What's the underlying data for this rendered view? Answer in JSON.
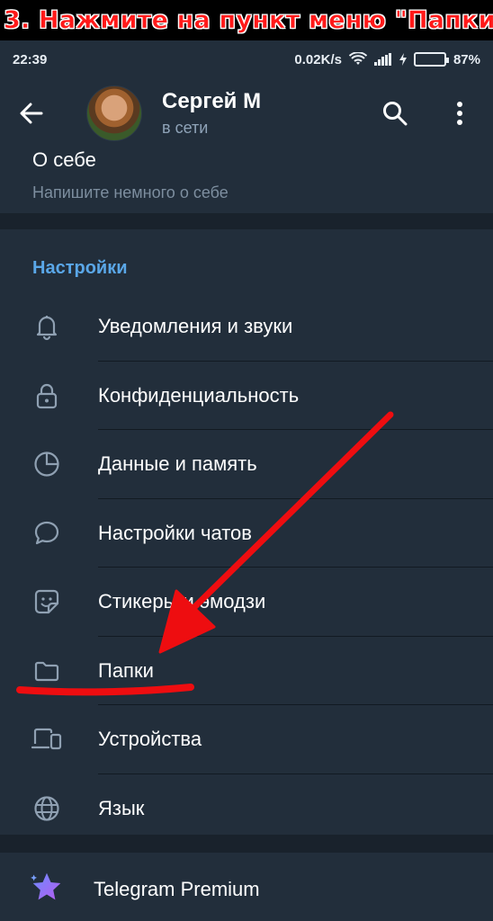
{
  "banner": {
    "text": "3. Нажмите на пункт меню \"Папки\""
  },
  "statusbar": {
    "time": "22:39",
    "speed": "0.02K/s",
    "battery": "87%",
    "battery_level": 0.87
  },
  "header": {
    "name": "Сергей М",
    "status": "в сети"
  },
  "about": {
    "title": "О себе",
    "hint": "Напишите немного о себе"
  },
  "settings": {
    "title": "Настройки",
    "items": [
      {
        "label": "Уведомления и звуки",
        "icon": "bell-icon"
      },
      {
        "label": "Конфиденциальность",
        "icon": "lock-icon"
      },
      {
        "label": "Данные и память",
        "icon": "pie-chart-icon"
      },
      {
        "label": "Настройки чатов",
        "icon": "chat-bubble-icon"
      },
      {
        "label": "Стикеры и эмодзи",
        "icon": "sticker-icon"
      },
      {
        "label": "Папки",
        "icon": "folder-icon"
      },
      {
        "label": "Устройства",
        "icon": "devices-icon"
      },
      {
        "label": "Язык",
        "icon": "globe-icon"
      }
    ]
  },
  "premium": {
    "label": "Telegram Premium",
    "icon": "star-icon"
  },
  "colors": {
    "accent": "#5aa7e8",
    "background": "#1d2733",
    "annotation": "#ee0d10",
    "premium_star": "#8b5cf6"
  }
}
